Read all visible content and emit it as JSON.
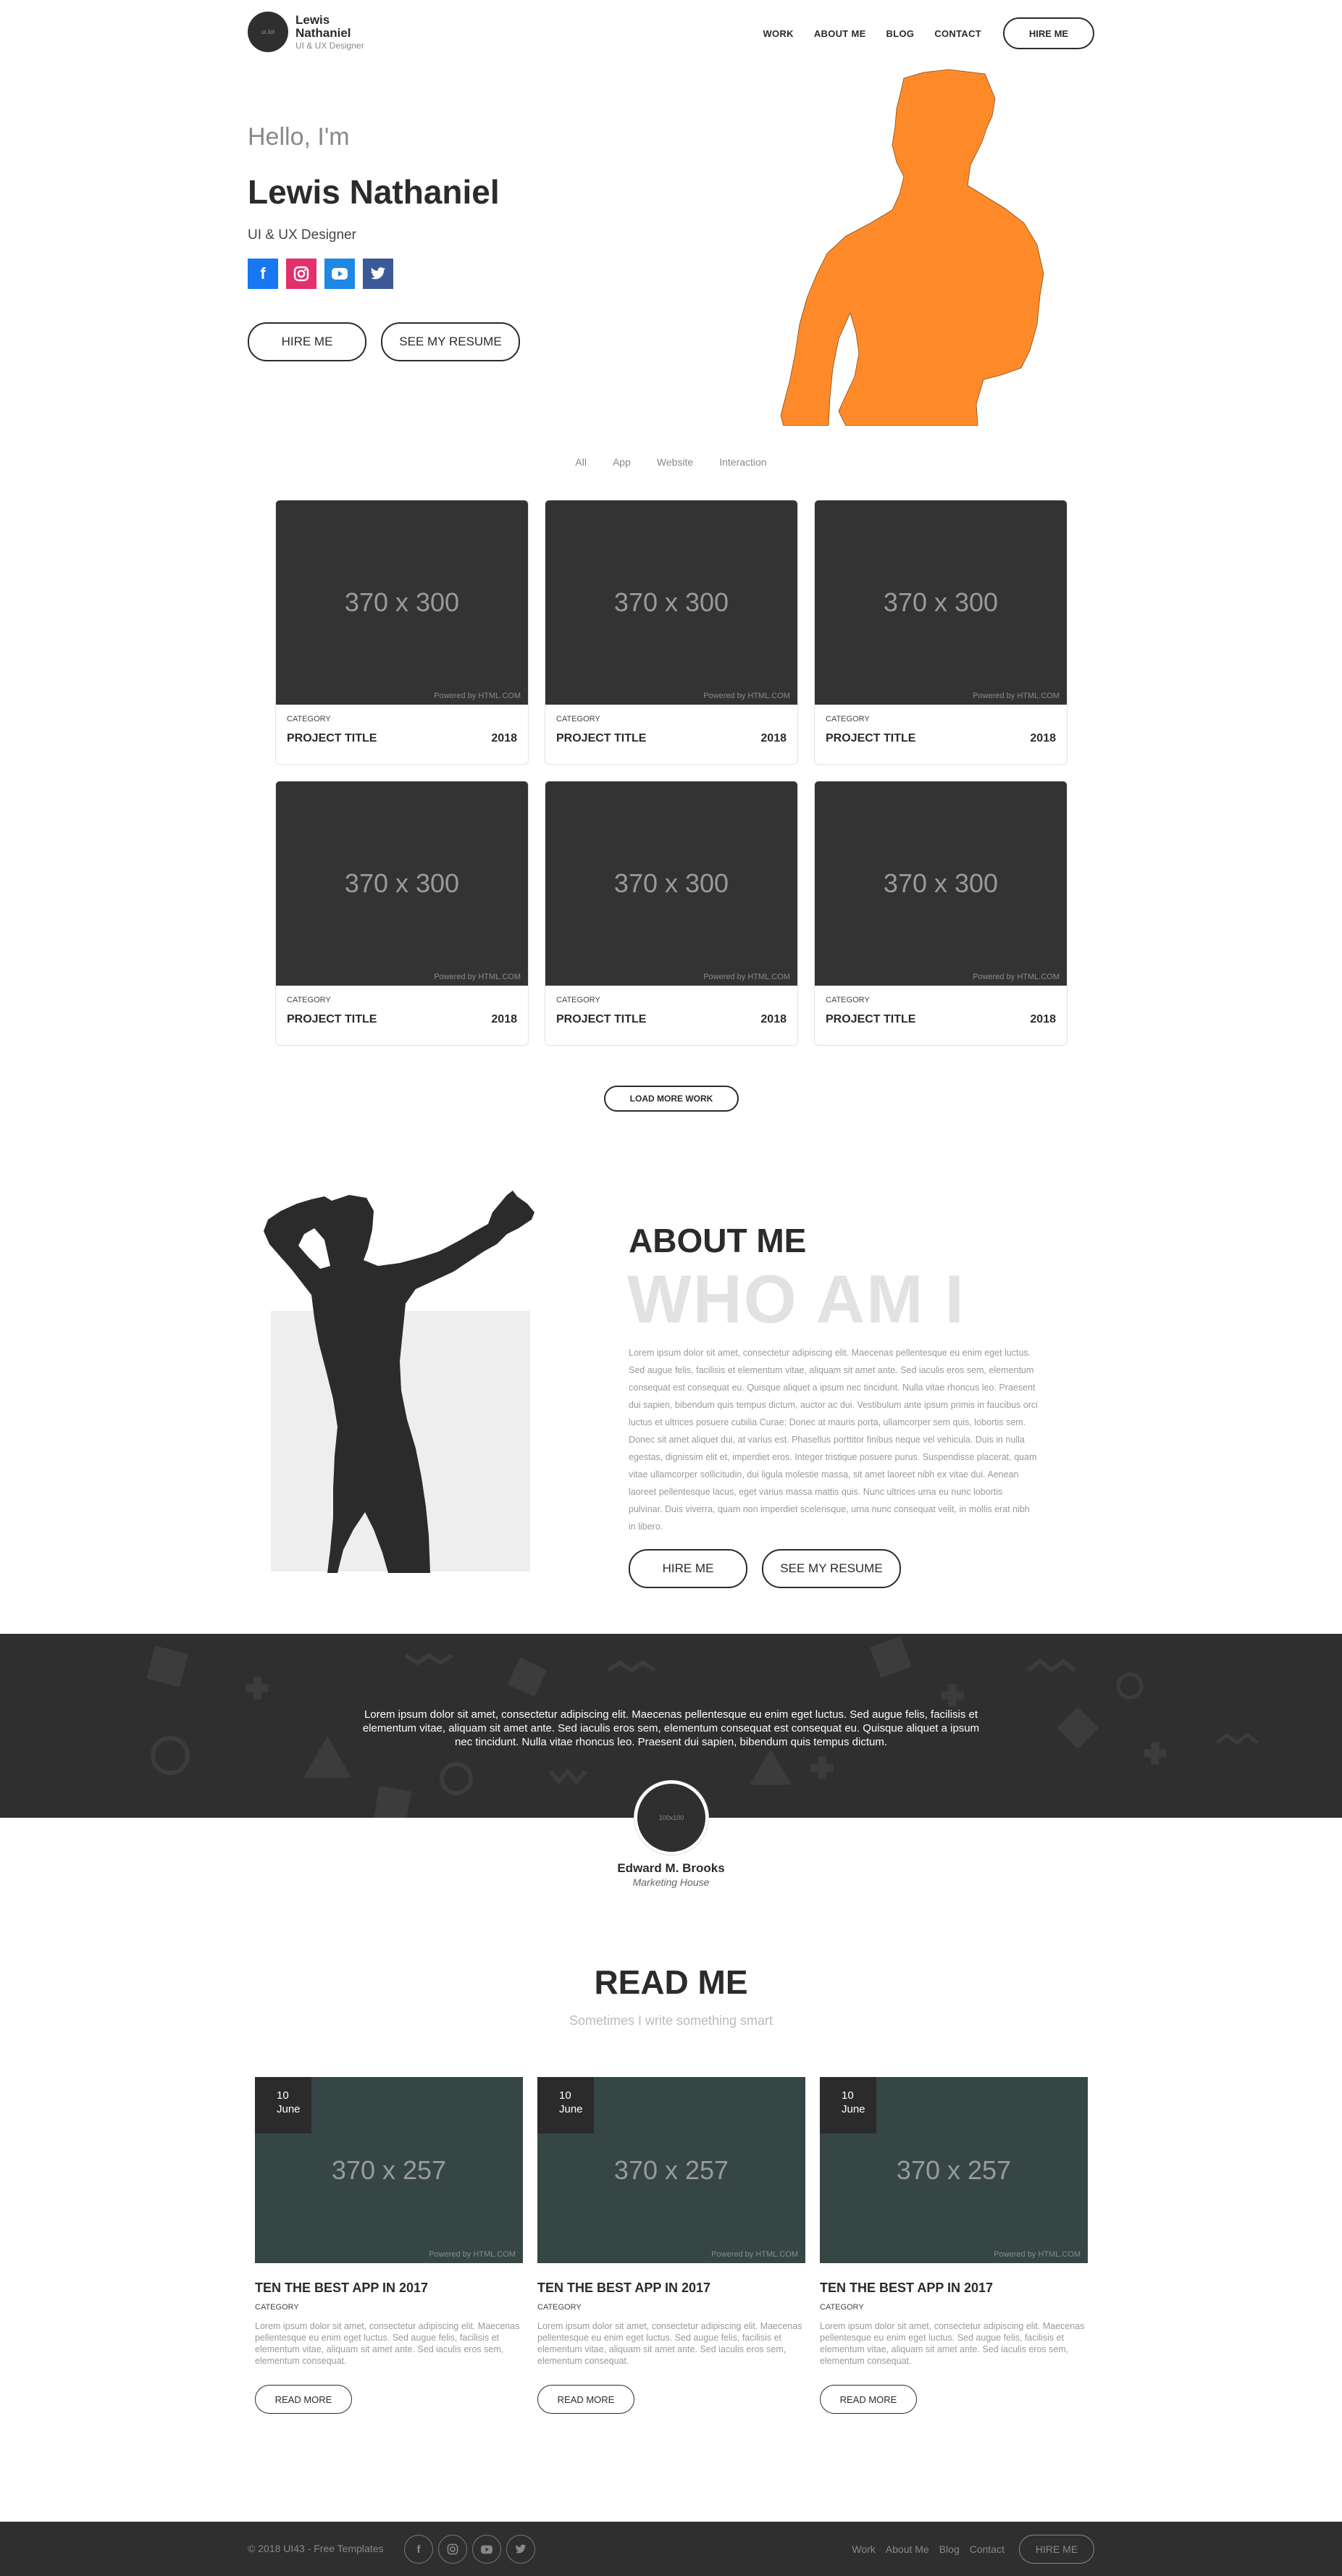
{
  "nav": {
    "logo_text": "ui.kit",
    "brand_name": "Lewis Nathaniel",
    "brand_role": "UI & UX Designer",
    "links": [
      "WORK",
      "ABOUT ME",
      "BLOG",
      "CONTACT"
    ],
    "hire_label": "HIRE ME"
  },
  "hero": {
    "greeting": "Hello, I'm",
    "name": "Lewis Nathaniel",
    "role": "UI & UX Designer",
    "socials": [
      "facebook-icon",
      "instagram-icon",
      "youtube-icon",
      "twitter-icon"
    ],
    "hire_label": "HIRE ME",
    "resume_label": "SEE MY RESUME",
    "accent_color": "#ff8a2a"
  },
  "portfolio": {
    "filters": [
      "All",
      "App",
      "Website",
      "Interaction"
    ],
    "cards": [
      {
        "thumb": "370 x 300",
        "credit": "Powered by HTML.COM",
        "category": "CATEGORY",
        "title": "PROJECT TITLE",
        "year": "2018"
      },
      {
        "thumb": "370 x 300",
        "credit": "Powered by HTML.COM",
        "category": "CATEGORY",
        "title": "PROJECT TITLE",
        "year": "2018"
      },
      {
        "thumb": "370 x 300",
        "credit": "Powered by HTML.COM",
        "category": "CATEGORY",
        "title": "PROJECT TITLE",
        "year": "2018"
      },
      {
        "thumb": "370 x 300",
        "credit": "Powered by HTML.COM",
        "category": "CATEGORY",
        "title": "PROJECT TITLE",
        "year": "2018"
      },
      {
        "thumb": "370 x 300",
        "credit": "Powered by HTML.COM",
        "category": "CATEGORY",
        "title": "PROJECT TITLE",
        "year": "2018"
      },
      {
        "thumb": "370 x 300",
        "credit": "Powered by HTML.COM",
        "category": "CATEGORY",
        "title": "PROJECT TITLE",
        "year": "2018"
      }
    ],
    "load_more_label": "LOAD MORE WORK"
  },
  "about": {
    "title": "ABOUT ME",
    "watermark": "WHO AM I",
    "text": "Lorem ipsum dolor sit amet, consectetur adipiscing elit. Maecenas pellentesque eu enim eget luctus. Sed augue felis, facilisis et elementum vitae, aliquam sit amet ante. Sed iaculis eros sem, elementum consequat est consequat eu. Quisque aliquet a ipsum nec tincidunt. Nulla vitae rhoncus leo. Praesent dui sapien, bibendum quis tempus dictum, auctor ac dui. Vestibulum ante ipsum primis in faucibus orci luctus et ultrices posuere cubilia Curae; Donec at mauris porta, ullamcorper sem quis, lobortis sem. Donec sit amet aliquet dui, at varius est. Phasellus porttitor finibus neque vel vehicula. Duis in nulla egestas, dignissim elit et, imperdiet eros. Integer tristique posuere purus. Suspendisse placerat, quam vitae ullamcorper sollicitudin, dui ligula molestie massa, sit amet laoreet nibh ex vitae dui. Aenean laoreet pellentesque lacus, eget varius massa mattis quis. Nunc ultrices urna eu nunc lobortis pulvinar. Duis viverra, quam non imperdiet scelerisque, urna nunc consequat velit, in mollis erat nibh in libero.",
    "hire_label": "HIRE ME",
    "resume_label": "SEE MY RESUME"
  },
  "testimonial": {
    "quote": "Lorem ipsum dolor sit amet, consectetur adipiscing elit. Maecenas pellentesque eu enim eget luctus. Sed augue felis, facilisis et elementum vitae, aliquam sit amet ante. Sed iaculis eros sem, elementum consequat est consequat eu. Quisque aliquet a ipsum nec tincidunt. Nulla vitae rhoncus leo. Praesent dui sapien, bibendum quis tempus dictum.",
    "avatar_text": "100x100",
    "name": "Edward M. Brooks",
    "company": "Marketing House"
  },
  "blog": {
    "title": "READ ME",
    "subtitle": "Sometimes I write something smart",
    "posts": [
      {
        "day": "10",
        "month": "June",
        "thumb": "370 x 257",
        "credit": "Powered by HTML.COM",
        "title": "TEN THE BEST APP IN 2017",
        "category": "CATEGORY",
        "excerpt": "Lorem ipsum dolor sit amet, consectetur adipiscing elit. Maecenas pellentesque eu enim eget luctus. Sed augue felis, facilisis et elementum vitae, aliquam sit amet ante. Sed iaculis eros sem, elementum consequat.",
        "button": "READ MORE"
      },
      {
        "day": "10",
        "month": "June",
        "thumb": "370 x 257",
        "credit": "Powered by HTML.COM",
        "title": "TEN THE BEST APP IN 2017",
        "category": "CATEGORY",
        "excerpt": "Lorem ipsum dolor sit amet, consectetur adipiscing elit. Maecenas pellentesque eu enim eget luctus. Sed augue felis, facilisis et elementum vitae, aliquam sit amet ante. Sed iaculis eros sem, elementum consequat.",
        "button": "READ MORE"
      },
      {
        "day": "10",
        "month": "June",
        "thumb": "370 x 257",
        "credit": "Powered by HTML.COM",
        "title": "TEN THE BEST APP IN 2017",
        "category": "CATEGORY",
        "excerpt": "Lorem ipsum dolor sit amet, consectetur adipiscing elit. Maecenas pellentesque eu enim eget luctus. Sed augue felis, facilisis et elementum vitae, aliquam sit amet ante. Sed iaculis eros sem, elementum consequat.",
        "button": "READ MORE"
      }
    ]
  },
  "footer": {
    "copyright": "© 2018 UI43 - Free Templates",
    "socials": [
      "facebook-icon",
      "instagram-icon",
      "youtube-icon",
      "twitter-icon"
    ],
    "links": [
      "Work",
      "About Me",
      "Blog",
      "Contact"
    ],
    "hire_label": "HIRE ME"
  }
}
